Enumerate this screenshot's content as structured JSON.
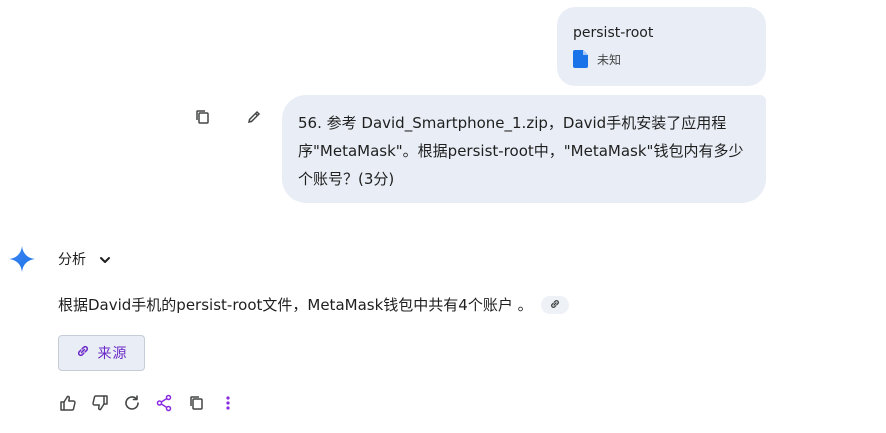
{
  "attachment": {
    "name": "persist-root",
    "type_label": "未知",
    "icon": "document-icon"
  },
  "user_message": {
    "text": "56. 参考 David_Smartphone_1.zip，David手机安装了应用程序\"MetaMask\"。根据persist-root中，\"MetaMask\"钱包内有多少个账号？(3分)",
    "actions": [
      "copy-icon",
      "edit-icon"
    ]
  },
  "response": {
    "avatar": "gemini-spark-icon",
    "analysis_label": "分析",
    "answer_text": "根据David手机的persist-root文件，MetaMask钱包中共有4个账户 。",
    "sources_label": "来源",
    "action_icons": [
      "thumbs-up-icon",
      "thumbs-down-icon",
      "regenerate-icon",
      "share-icon",
      "copy-icon",
      "more-vert-icon"
    ]
  },
  "colors": {
    "bubble_bg": "#e9eef6",
    "accent_purple": "#6b2ac9",
    "file_blue": "#1a73e8",
    "star_blue": "#3b82f6"
  }
}
